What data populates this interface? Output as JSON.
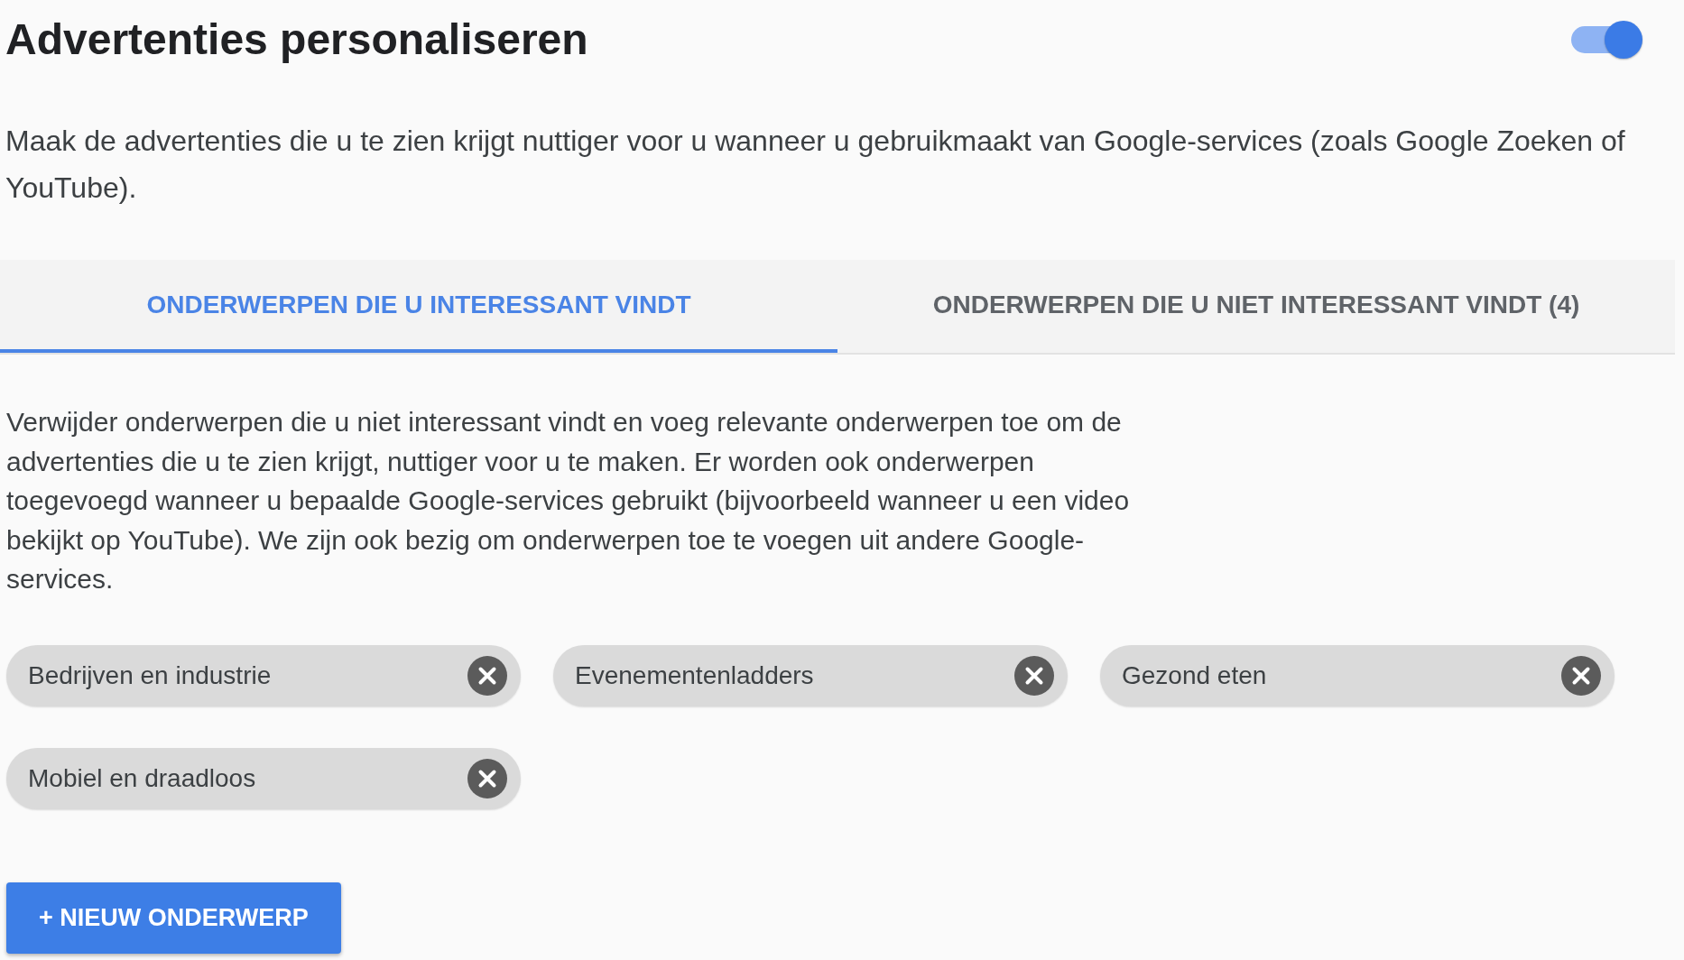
{
  "header": {
    "title": "Advertenties personaliseren",
    "toggle": {
      "on": true
    }
  },
  "description": "Maak de advertenties die u te zien krijgt nuttiger voor u wanneer u gebruikmaakt van Google-services (zoals Google Zoeken of YouTube).",
  "tabs": [
    {
      "label": "ONDERWERPEN DIE U INTERESSANT VINDT",
      "selected": true
    },
    {
      "label": "ONDERWERPEN DIE U NIET INTERESSANT VINDT (4)",
      "selected": false
    }
  ],
  "topics_panel": {
    "intro": "Verwijder onderwerpen die u niet interessant vindt en voeg relevante onderwerpen toe om de advertenties die u te zien krijgt, nuttiger voor u te maken. Er worden ook onderwerpen toegevoegd wanneer u bepaalde Google-services gebruikt (bijvoorbeeld wanneer u een video bekijkt op YouTube). We zijn ook bezig om onderwerpen toe te voegen uit andere Google-services.",
    "topics": [
      "Bedrijven en industrie",
      "Evenementenladders",
      "Gezond eten",
      "Mobiel en draadloos"
    ],
    "add_button": "+ NIEUW ONDERWERP"
  }
}
